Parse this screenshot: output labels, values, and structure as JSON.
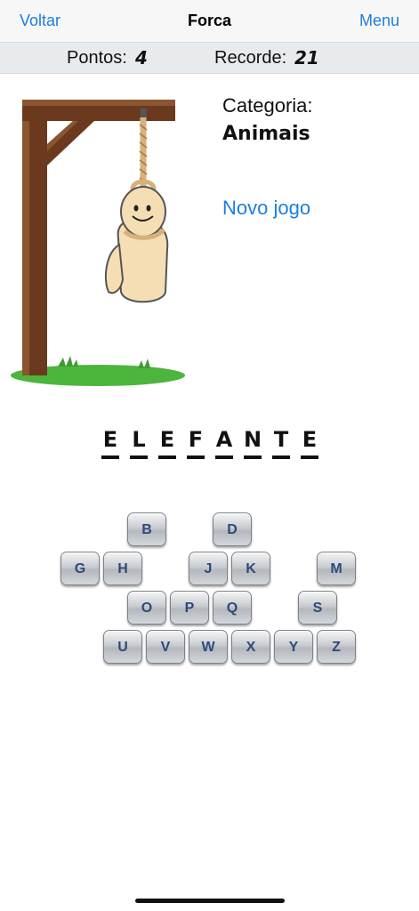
{
  "nav": {
    "back_label": "Voltar",
    "title": "Forca",
    "menu_label": "Menu"
  },
  "score": {
    "points_label": "Pontos:",
    "points_value": "4",
    "record_label": "Recorde:",
    "record_value": "21"
  },
  "category": {
    "label": "Categoria:",
    "value": "Animais"
  },
  "new_game_label": "Novo jogo",
  "word": [
    "E",
    "L",
    "E",
    "F",
    "A",
    "N",
    "T",
    "E"
  ],
  "keys": [
    "B",
    "D",
    "G",
    "H",
    "J",
    "K",
    "M",
    "O",
    "P",
    "Q",
    "S",
    "U",
    "V",
    "W",
    "X",
    "Y",
    "Z"
  ],
  "colors": {
    "accent": "#1a7fe0",
    "key_text": "#2f4a7a",
    "wood": "#6b3a1e",
    "grass": "#4cb53c",
    "rope": "#d7b07a",
    "figure": "#f5deb3"
  }
}
